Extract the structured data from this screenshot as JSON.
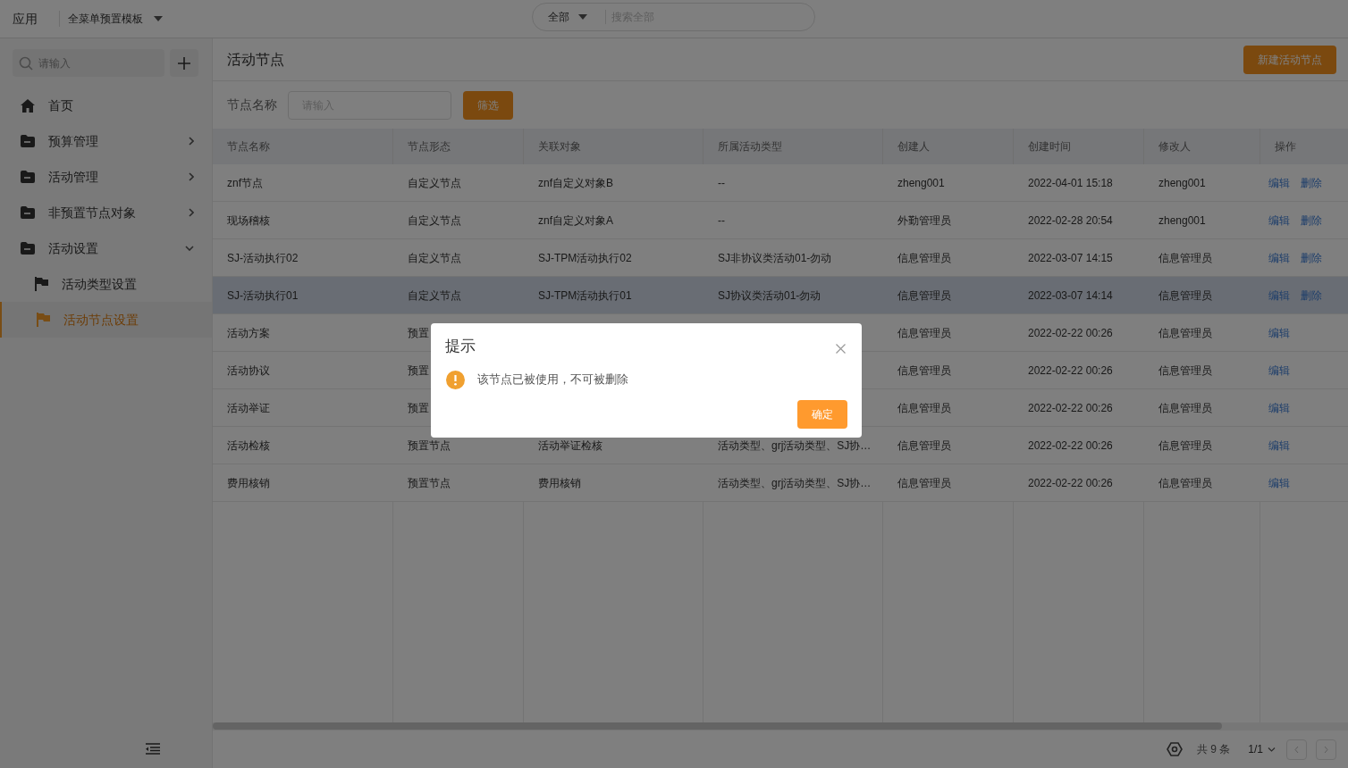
{
  "header": {
    "app_label": "应用",
    "template": "全菜单预置模板",
    "search_scope": "全部",
    "search_placeholder": "搜索全部"
  },
  "sidebar": {
    "search_placeholder": "请输入",
    "items": [
      {
        "label": "首页"
      },
      {
        "label": "预算管理",
        "expanded": false
      },
      {
        "label": "活动管理",
        "expanded": false
      },
      {
        "label": "非预置节点对象",
        "expanded": false
      },
      {
        "label": "活动设置",
        "expanded": true,
        "children": [
          {
            "label": "活动类型设置",
            "selected": false
          },
          {
            "label": "活动节点设置",
            "selected": true
          }
        ]
      }
    ]
  },
  "page": {
    "title": "活动节点",
    "new_button": "新建活动节点",
    "filter_label": "节点名称",
    "filter_placeholder": "请输入",
    "filter_button": "筛选"
  },
  "table": {
    "columns": [
      "节点名称",
      "节点形态",
      "关联对象",
      "所属活动类型",
      "创建人",
      "创建时间",
      "修改人",
      "操作"
    ],
    "rows": [
      {
        "highlighted": false,
        "cells": [
          "znf节点",
          "自定义节点",
          "znf自定义对象B",
          "--",
          "zheng001",
          "2022-04-01 15:18",
          "zheng001"
        ],
        "actions": [
          "编辑",
          "删除"
        ]
      },
      {
        "highlighted": false,
        "cells": [
          "现场稽核",
          "自定义节点",
          "znf自定义对象A",
          "--",
          "外勤管理员",
          "2022-02-28 20:54",
          "zheng001"
        ],
        "actions": [
          "编辑",
          "删除"
        ]
      },
      {
        "highlighted": false,
        "cells": [
          "SJ-活动执行02",
          "自定义节点",
          "SJ-TPM活动执行02",
          "SJ非协议类活动01-勿动",
          "信息管理员",
          "2022-03-07 14:15",
          "信息管理员"
        ],
        "actions": [
          "编辑",
          "删除"
        ]
      },
      {
        "highlighted": true,
        "cells": [
          "SJ-活动执行01",
          "自定义节点",
          "SJ-TPM活动执行01",
          "SJ协议类活动01-勿动",
          "信息管理员",
          "2022-03-07 14:14",
          "信息管理员"
        ],
        "actions": [
          "编辑",
          "删除"
        ]
      },
      {
        "highlighted": false,
        "cells": [
          "活动方案",
          "预置",
          null,
          null,
          "信息管理员",
          "2022-02-22 00:26",
          "信息管理员"
        ],
        "actions": [
          "编辑"
        ]
      },
      {
        "highlighted": false,
        "cells": [
          "活动协议",
          "预置",
          null,
          null,
          "信息管理员",
          "2022-02-22 00:26",
          "信息管理员"
        ],
        "actions": [
          "编辑"
        ]
      },
      {
        "highlighted": false,
        "cells": [
          "活动举证",
          "预置",
          null,
          null,
          "信息管理员",
          "2022-02-22 00:26",
          "信息管理员"
        ],
        "actions": [
          "编辑"
        ]
      },
      {
        "highlighted": false,
        "cells": [
          "活动检核",
          "预置节点",
          "活动举证检核",
          "活动类型、grj活动类型、SJ协…",
          "信息管理员",
          "2022-02-22 00:26",
          "信息管理员"
        ],
        "actions": [
          "编辑"
        ]
      },
      {
        "highlighted": false,
        "cells": [
          "费用核销",
          "预置节点",
          "费用核销",
          "活动类型、grj活动类型、SJ协…",
          "信息管理员",
          "2022-02-22 00:26",
          "信息管理员"
        ],
        "actions": [
          "编辑"
        ]
      }
    ]
  },
  "footer": {
    "total": "共 9 条",
    "page": "1/1"
  },
  "dialog": {
    "title": "提示",
    "message": "该节点已被使用，不可被删除",
    "confirm": "确定"
  }
}
